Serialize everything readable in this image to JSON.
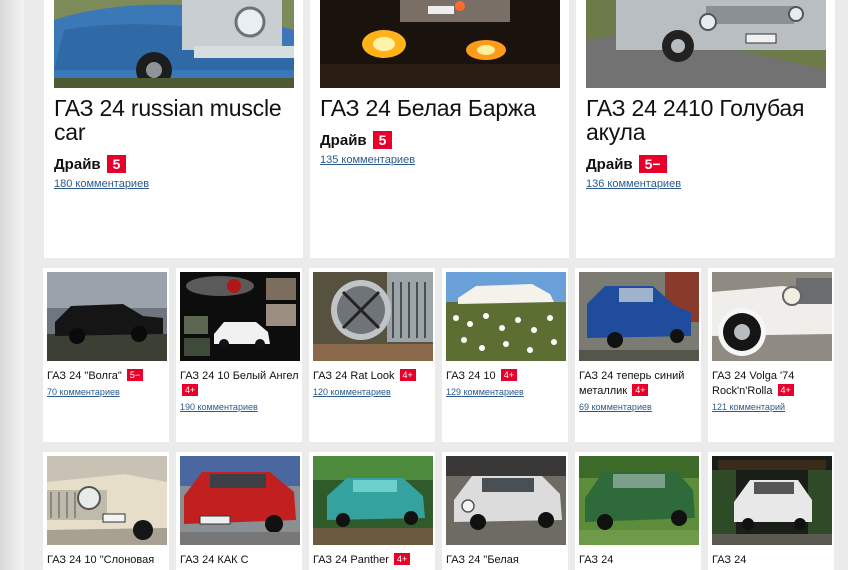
{
  "featured": [
    {
      "title": "ГАЗ 24 russian muscle car",
      "drive_label": "Драйв",
      "rating": "5",
      "comments": "180 комментариев",
      "photo": "blue-volga-closeup"
    },
    {
      "title": "ГАЗ 24 Белая Баржа",
      "drive_label": "Драйв",
      "rating": "5",
      "comments": "135 комментариев",
      "photo": "car-flames-night"
    },
    {
      "title": "ГАЗ 24 2410 Голубая акула",
      "drive_label": "Драйв",
      "rating": "5−",
      "comments": "136 комментариев",
      "photo": "silver-volga-street"
    }
  ],
  "row1": [
    {
      "title": "ГАЗ 24 \"Волга\"",
      "rating": "5−",
      "comments": "70 комментариев",
      "photo": "black-volga"
    },
    {
      "title": "ГАЗ 24 10 Белый Ангел",
      "rating": "4+",
      "comments": "190 комментариев",
      "photo": "white-volga-collage"
    },
    {
      "title": "ГАЗ 24 Rat Look",
      "rating": "4+",
      "comments": "120 комментариев",
      "photo": "headlight-closeup"
    },
    {
      "title": "ГАЗ 24 10",
      "rating": "4+",
      "comments": "129 комментариев",
      "photo": "white-volga-flowers"
    },
    {
      "title": "ГАЗ 24 теперь синий металлик",
      "rating": "4+",
      "comments": "69 комментариев",
      "photo": "blue-metallic-volga"
    },
    {
      "title": "ГАЗ 24 Volga '74 Rock'n'Rolla",
      "rating": "4+",
      "comments": "121 комментарий",
      "photo": "white-whitewall-volga"
    }
  ],
  "row2": [
    {
      "title": "ГАЗ 24 10 \"Слоновая",
      "rating": "",
      "comments": "",
      "photo": "ivory-volga-front"
    },
    {
      "title": "ГАЗ 24 КАК С",
      "rating": "",
      "comments": "",
      "photo": "red-volga"
    },
    {
      "title": "ГАЗ 24 Panther",
      "rating": "4+",
      "comments": "",
      "photo": "teal-volga"
    },
    {
      "title": "ГАЗ 24 \"Белая",
      "rating": "",
      "comments": "",
      "photo": "white-volga-garage"
    },
    {
      "title": "ГАЗ 24",
      "rating": "",
      "comments": "",
      "photo": "green-volga"
    },
    {
      "title": "ГАЗ 24",
      "rating": "",
      "comments": "",
      "photo": "white-volga-carport"
    }
  ],
  "colors": {
    "accent": "#e8002a",
    "link": "#2b5b8a",
    "background": "#ebebeb",
    "card": "#ffffff"
  }
}
